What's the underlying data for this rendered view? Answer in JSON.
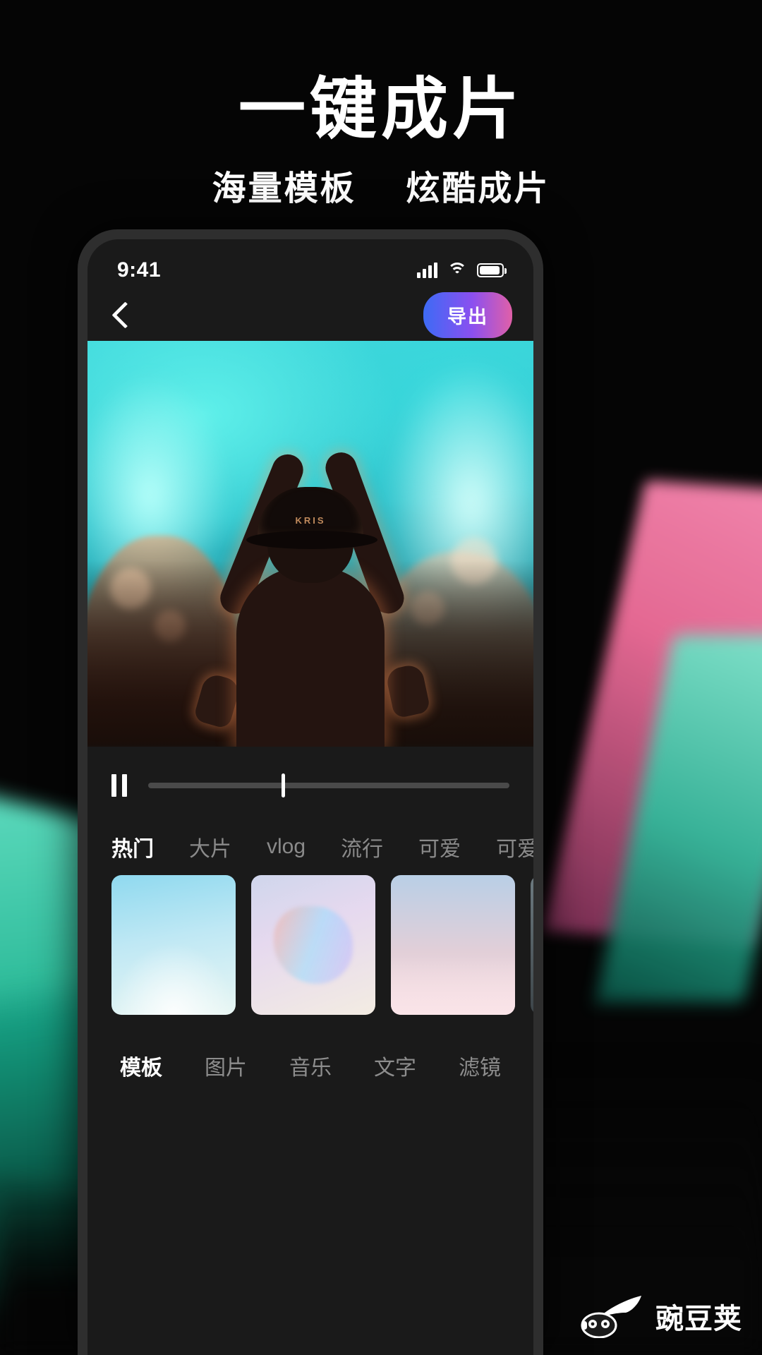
{
  "promo": {
    "headline": "一键成片",
    "subtitle_left": "海量模板",
    "subtitle_right": "炫酷成片"
  },
  "phone": {
    "status_bar": {
      "time": "9:41",
      "signal_icon": "cellular-signal-icon",
      "wifi_icon": "wifi-icon",
      "battery_icon": "battery-icon"
    },
    "nav": {
      "back_icon": "back-chevron-icon",
      "export_label": "导出"
    },
    "player": {
      "pause_icon": "pause-icon",
      "progress_percent": 37
    },
    "preview": {
      "cap_text": "KRIS"
    },
    "categories": [
      {
        "label": "热门",
        "active": true
      },
      {
        "label": "大片",
        "active": false
      },
      {
        "label": "vlog",
        "active": false
      },
      {
        "label": "流行",
        "active": false
      },
      {
        "label": "可爱",
        "active": false
      },
      {
        "label": "可爱",
        "active": false
      }
    ],
    "templates": [
      {
        "name": "template-underwater"
      },
      {
        "name": "template-hand-rainbow"
      },
      {
        "name": "template-pink-sky"
      },
      {
        "name": "template-partial"
      }
    ],
    "bottom_nav": [
      {
        "label": "模板",
        "active": true
      },
      {
        "label": "图片",
        "active": false
      },
      {
        "label": "音乐",
        "active": false
      },
      {
        "label": "文字",
        "active": false
      },
      {
        "label": "滤镜",
        "active": false
      }
    ]
  },
  "watermark": {
    "text": "豌豆荚",
    "logo_icon": "pea-pod-logo-icon"
  },
  "colors": {
    "export_gradient_start": "#3d6bf5",
    "export_gradient_mid": "#8b4ff0",
    "export_gradient_end": "#e060a8",
    "accent_teal": "#35c9a6",
    "accent_pink": "#f06e9a",
    "background": "#050505"
  }
}
